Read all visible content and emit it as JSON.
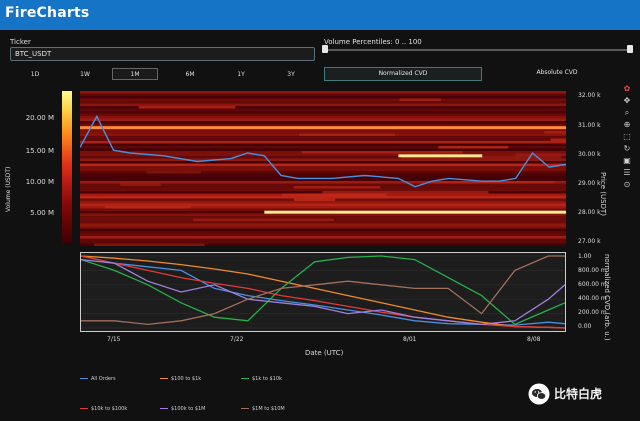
{
  "app": {
    "title": "FireCharts"
  },
  "ticker": {
    "label": "Ticker",
    "value": "BTC_USDT"
  },
  "volume_percentiles": {
    "label": "Volume Percentiles: 0 .. 100",
    "min": 0,
    "max": 100
  },
  "range_buttons": [
    {
      "label": "1D",
      "active": false
    },
    {
      "label": "1W",
      "active": false
    },
    {
      "label": "1M",
      "active": true
    },
    {
      "label": "6M",
      "active": false
    },
    {
      "label": "1Y",
      "active": false
    },
    {
      "label": "3Y",
      "active": false
    }
  ],
  "cvd_buttons": [
    {
      "label": "Normalized CVD",
      "active": true
    },
    {
      "label": "Absolute CVD",
      "active": false
    }
  ],
  "colorbar": {
    "label": "Volume (USDT)",
    "ticks": [
      "20.00 M",
      "15.00 M",
      "10.00 M",
      "5.00 M"
    ]
  },
  "price_axis": {
    "label": "Price (USDT)",
    "ticks": [
      "32.00 k",
      "31.00 k",
      "30.00 k",
      "29.00 k",
      "28.00 k",
      "27.00 k"
    ]
  },
  "cvd_axis": {
    "label": "normalized CVD (arb. u.)",
    "ticks": [
      "1.00",
      "800.00 m",
      "600.00 m",
      "400.00 m",
      "200.00 m",
      "0.00"
    ]
  },
  "x_axis": {
    "label": "Date (UTC)",
    "ticks": [
      "7/15",
      "7/22",
      "8/01",
      "8/08"
    ]
  },
  "legend": [
    {
      "label": "All Orders",
      "color": "#4a8fe0"
    },
    {
      "label": "$100 to $1k",
      "color": "#f08a2a"
    },
    {
      "label": "$1k to $10k",
      "color": "#28b04a"
    },
    {
      "label": "$10k to $100k",
      "color": "#e03a3a"
    },
    {
      "label": "$100k to $1M",
      "color": "#a080e0"
    },
    {
      "label": "$1M to $10M",
      "color": "#a0705a"
    }
  ],
  "watermark": {
    "text": "比特白虎"
  },
  "chart_data": [
    {
      "type": "heatmap",
      "title": "",
      "xlabel": "",
      "ylabel": "Price (USDT)",
      "ylim": [
        26800,
        32300
      ],
      "colorbar": {
        "label": "Volume (USDT)",
        "range": [
          0,
          24000000
        ]
      },
      "highlight_levels": [
        {
          "price": 31000,
          "x_start": "7/13",
          "x_end": "8/11",
          "intensity": "medium"
        },
        {
          "price": 30000,
          "x_start": "8/01",
          "x_end": "8/06",
          "intensity": "high"
        },
        {
          "price": 28000,
          "x_start": "7/24",
          "x_end": "8/11",
          "intensity": "high"
        }
      ],
      "series": [
        {
          "name": "",
          "color": "#4a8fe0",
          "x": [
            "7/13",
            "7/14",
            "7/15",
            "7/16",
            "7/18",
            "7/20",
            "7/22",
            "7/23",
            "7/24",
            "7/25",
            "7/26",
            "7/28",
            "7/30",
            "8/01",
            "8/02",
            "8/03",
            "8/04",
            "8/05",
            "8/06",
            "8/07",
            "8/08",
            "8/09",
            "8/10",
            "8/11"
          ],
          "y": [
            30300,
            31400,
            30200,
            30100,
            30000,
            29800,
            29900,
            30100,
            30000,
            29300,
            29200,
            29200,
            29300,
            29200,
            28900,
            29100,
            29200,
            29150,
            29100,
            29100,
            29200,
            30100,
            29600,
            29700
          ]
        }
      ]
    },
    {
      "type": "line",
      "title": "",
      "xlabel": "Date (UTC)",
      "ylabel": "normalized CVD (arb. u.)",
      "ylim": [
        0,
        1
      ],
      "x": [
        "7/13",
        "7/15",
        "7/17",
        "7/19",
        "7/21",
        "7/23",
        "7/25",
        "7/27",
        "7/29",
        "7/31",
        "8/02",
        "8/04",
        "8/06",
        "8/08",
        "8/10",
        "8/11"
      ],
      "series": [
        {
          "name": "All Orders",
          "values": [
            1.0,
            0.9,
            0.85,
            0.8,
            0.55,
            0.45,
            0.38,
            0.32,
            0.25,
            0.18,
            0.1,
            0.06,
            0.05,
            0.04,
            0.08,
            0.06
          ]
        },
        {
          "name": "$100 to $1k",
          "values": [
            1.0,
            0.97,
            0.93,
            0.88,
            0.82,
            0.75,
            0.65,
            0.55,
            0.45,
            0.35,
            0.25,
            0.15,
            0.08,
            0.02,
            0.01,
            0.0
          ]
        },
        {
          "name": "$1k to $10k",
          "values": [
            0.95,
            0.8,
            0.6,
            0.35,
            0.15,
            0.1,
            0.55,
            0.92,
            0.98,
            1.0,
            0.95,
            0.7,
            0.45,
            0.05,
            0.25,
            0.35
          ]
        },
        {
          "name": "$10k to $100k",
          "values": [
            1.0,
            0.9,
            0.8,
            0.7,
            0.62,
            0.55,
            0.45,
            0.38,
            0.3,
            0.22,
            0.15,
            0.1,
            0.05,
            0.02,
            0.01,
            0.0
          ]
        },
        {
          "name": "$100k to $1M",
          "values": [
            0.95,
            0.9,
            0.65,
            0.5,
            0.6,
            0.4,
            0.35,
            0.3,
            0.2,
            0.25,
            0.15,
            0.1,
            0.05,
            0.1,
            0.4,
            0.6
          ]
        },
        {
          "name": "$1M to $10M",
          "values": [
            0.1,
            0.1,
            0.05,
            0.1,
            0.2,
            0.4,
            0.55,
            0.6,
            0.65,
            0.6,
            0.55,
            0.55,
            0.2,
            0.8,
            1.0,
            1.0
          ]
        }
      ]
    }
  ]
}
